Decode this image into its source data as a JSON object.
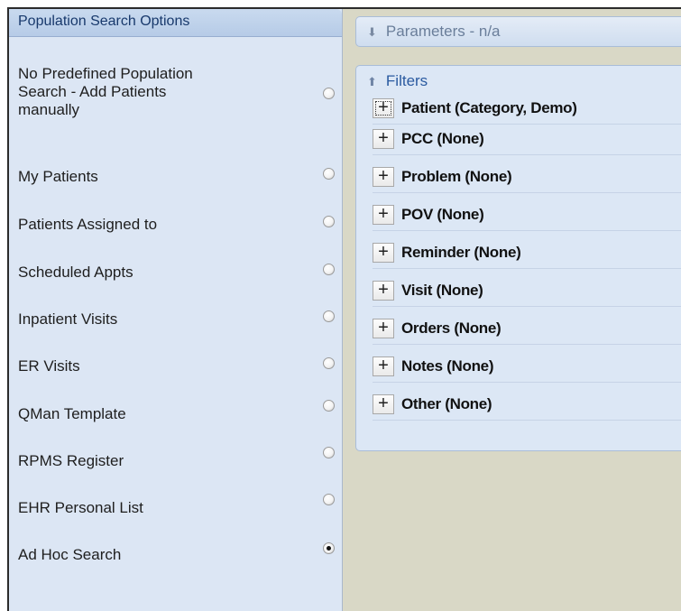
{
  "left_panel": {
    "title": "Population Search Options",
    "options": [
      {
        "label_lines": [
          "No Predefined Population",
          "Search - Add Patients",
          "manually"
        ],
        "selected": false
      },
      {
        "label": "My Patients",
        "selected": false
      },
      {
        "label": "Patients Assigned to",
        "selected": false
      },
      {
        "label": "Scheduled Appts",
        "selected": false
      },
      {
        "label": "Inpatient Visits",
        "selected": false
      },
      {
        "label": "ER Visits",
        "selected": false
      },
      {
        "label": "QMan Template",
        "selected": false
      },
      {
        "label": "RPMS Register",
        "selected": false
      },
      {
        "label": "EHR Personal List",
        "selected": false
      },
      {
        "label": "Ad Hoc Search",
        "selected": true
      }
    ]
  },
  "parameters": {
    "label": "Parameters - n/a",
    "icon": "chevron-double-down-icon"
  },
  "filters": {
    "title": "Filters",
    "icon": "chevron-double-up-icon",
    "items": [
      {
        "expander": "+",
        "label": "Patient (Category, Demo)"
      },
      {
        "expander": "+",
        "label": "PCC (None)"
      },
      {
        "expander": "+",
        "label": "Problem (None)"
      },
      {
        "expander": "+",
        "label": "POV (None)"
      },
      {
        "expander": "+",
        "label": "Reminder (None)"
      },
      {
        "expander": "+",
        "label": "Visit (None)"
      },
      {
        "expander": "+",
        "label": "Orders (None)"
      },
      {
        "expander": "+",
        "label": "Notes (None)"
      },
      {
        "expander": "+",
        "label": "Other (None)"
      }
    ]
  }
}
